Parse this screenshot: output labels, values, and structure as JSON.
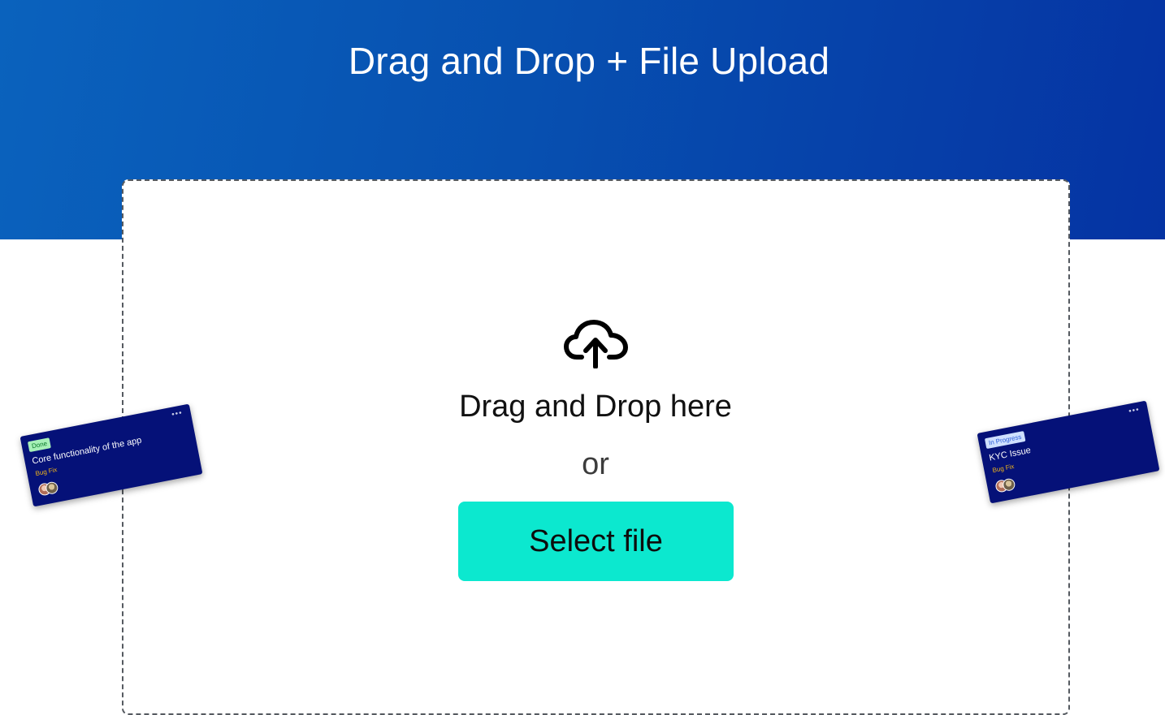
{
  "header": {
    "title": "Drag and Drop + File Upload"
  },
  "dropzone": {
    "icon": "cloud-upload-icon",
    "prompt": "Drag and Drop here",
    "separator": "or",
    "button_label": "Select file"
  },
  "cards": [
    {
      "status": "Done",
      "title": "Core functionality of the app",
      "tag": "Bug Fix",
      "menu": "•••"
    },
    {
      "status": "In Progress",
      "title": "KYC Issue",
      "tag": "Bug Fix",
      "menu": "•••"
    }
  ],
  "colors": {
    "header_gradient_start": "#0a62bd",
    "header_gradient_end": "#0533a3",
    "button": "#0ce8cf",
    "card_bg": "#051178",
    "tag": "#f2b619"
  }
}
